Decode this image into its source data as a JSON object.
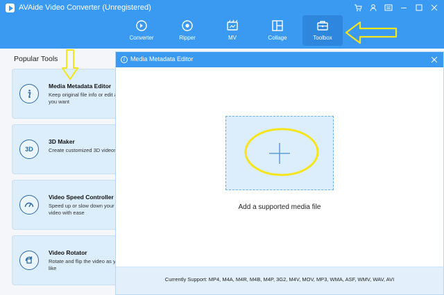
{
  "app": {
    "title": "AVAide Video Converter (Unregistered)"
  },
  "nav": {
    "items": [
      {
        "label": "Converter",
        "icon": "converter-icon"
      },
      {
        "label": "Ripper",
        "icon": "ripper-icon"
      },
      {
        "label": "MV",
        "icon": "mv-icon"
      },
      {
        "label": "Collage",
        "icon": "collage-icon"
      },
      {
        "label": "Toolbox",
        "icon": "toolbox-icon",
        "active": true
      }
    ]
  },
  "sidebar": {
    "title": "Popular Tools",
    "tools": [
      {
        "name": "Media Metadata Editor",
        "desc": "Keep original file info or edit as you want",
        "icon": "info-icon"
      },
      {
        "name": "3D Maker",
        "desc": "Create customized 3D videos",
        "icon": "3d-icon",
        "icon_text": "3D"
      },
      {
        "name": "Video Speed Controller",
        "desc": "Speed up or slow down your video with ease",
        "icon": "speedometer-icon"
      },
      {
        "name": "Video Rotator",
        "desc": "Rotate and flip the video as you like",
        "icon": "rotate-icon"
      }
    ]
  },
  "dialog": {
    "title": "Media Metadata Editor",
    "add_label": "Add a supported media file",
    "support_text": "Currently Support: MP4, M4A, M4R, M4B, M4P, 3G2, M4V, MOV, MP3, WMA, ASF, WMV, WAV, AVI"
  },
  "colors": {
    "accent": "#3a9af2",
    "card": "#dceefb",
    "annotation": "#f5e51a"
  }
}
